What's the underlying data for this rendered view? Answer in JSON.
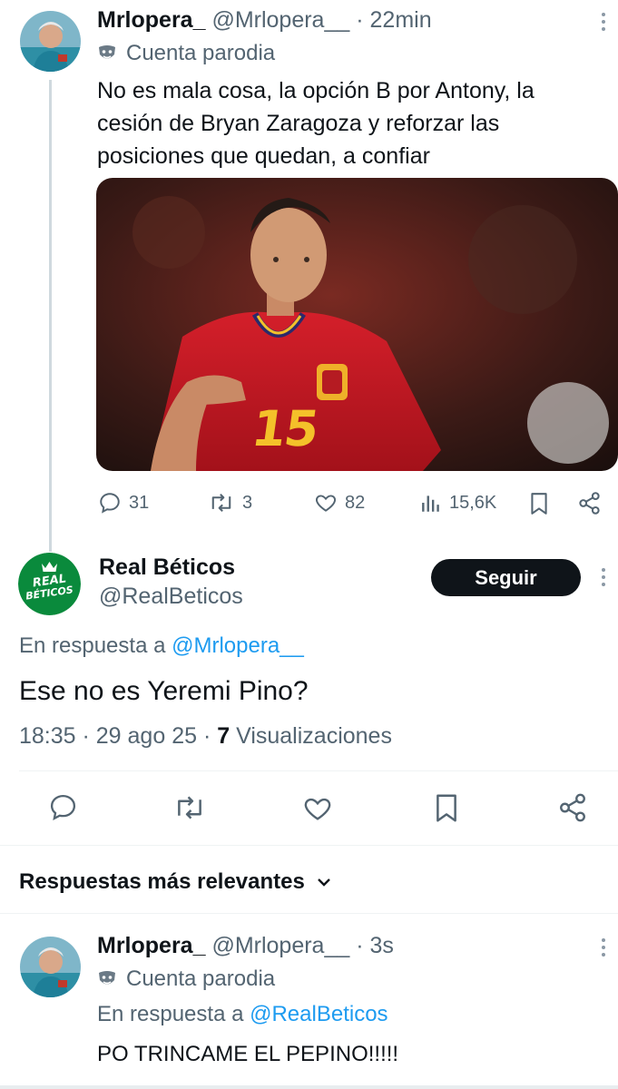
{
  "original_tweet": {
    "display_name": "Mrlopera_",
    "handle": "@Mrlopera__",
    "time": "· 22min",
    "parody_label": "Cuenta parodia",
    "text_lines": [
      "No es mala cosa, la opción B por Antony, la",
      "cesión de Bryan Zaragoza y reforzar las",
      "posiciones que quedan, a confiar"
    ],
    "jersey_number": "15",
    "stats": {
      "replies": "31",
      "retweets": "3",
      "likes": "82",
      "views": "15,6K"
    }
  },
  "main_tweet": {
    "display_name": "Real Béticos",
    "handle": "@RealBeticos",
    "avatar_text_top": "REAL",
    "avatar_text_bottom": "BÉTICOS",
    "follow_label": "Seguir",
    "reply_prefix": "En respuesta a",
    "reply_to": "@Mrlopera__",
    "text": "Ese no es Yeremi Pino?",
    "timestamp": "18:35 · 29 ago 25 ·",
    "views_count": "7",
    "views_label": "Visualizaciones"
  },
  "replies_section": {
    "sort_label": "Respuestas más relevantes"
  },
  "reply_tweet": {
    "display_name": "Mrlopera_",
    "handle": "@Mrlopera__",
    "time": "· 3s",
    "parody_label": "Cuenta parodia",
    "reply_prefix": "En respuesta a",
    "reply_to": "@RealBeticos",
    "text": "PO TRINCAME EL PEPINO!!!!!"
  },
  "colors": {
    "link": "#1d9bf0",
    "muted": "#536471",
    "follow_bg": "#0f1419",
    "betis_green": "#0a8a3c"
  }
}
